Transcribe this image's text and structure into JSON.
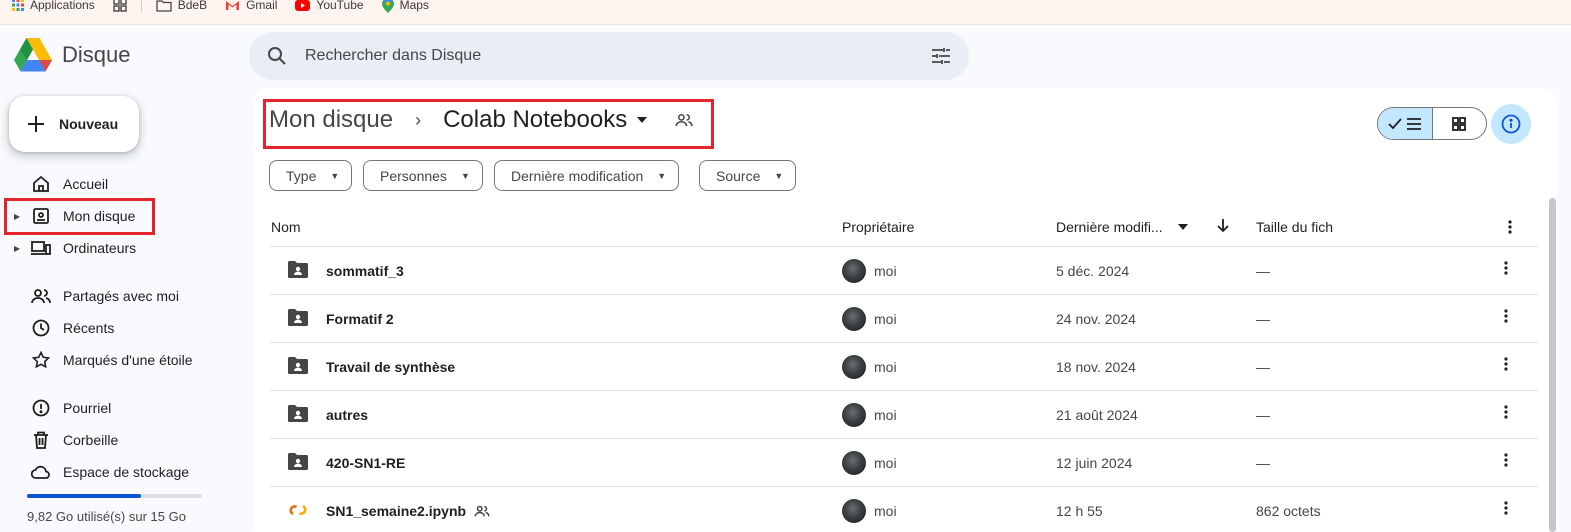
{
  "bookmarks": [
    {
      "label": "Applications",
      "icon": "apps-grid-icon"
    },
    {
      "label": "",
      "icon": "tab-groups-icon"
    },
    {
      "label": "BdeB",
      "icon": "folder-icon"
    },
    {
      "label": "Gmail",
      "icon": "gmail-icon"
    },
    {
      "label": "YouTube",
      "icon": "youtube-icon"
    },
    {
      "label": "Maps",
      "icon": "maps-icon"
    }
  ],
  "app": {
    "title": "Disque"
  },
  "search": {
    "placeholder": "Rechercher dans Disque"
  },
  "sidebar": {
    "new_label": "Nouveau",
    "items": [
      {
        "label": "Accueil",
        "icon": "home-icon"
      },
      {
        "label": "Mon disque",
        "icon": "my-drive-icon"
      },
      {
        "label": "Ordinateurs",
        "icon": "computers-icon"
      },
      {
        "label": "Partagés avec moi",
        "icon": "shared-icon"
      },
      {
        "label": "Récents",
        "icon": "clock-icon"
      },
      {
        "label": "Marqués d'une étoile",
        "icon": "star-icon"
      },
      {
        "label": "Pourriel",
        "icon": "spam-icon"
      },
      {
        "label": "Corbeille",
        "icon": "trash-icon"
      },
      {
        "label": "Espace de stockage",
        "icon": "cloud-icon"
      }
    ],
    "storage_text": "9,82 Go utilisé(s) sur 15 Go",
    "storage_used_fraction": 0.65
  },
  "breadcrumb": {
    "root": "Mon disque",
    "current": "Colab Notebooks"
  },
  "filters": [
    "Type",
    "Personnes",
    "Dernière modification",
    "Source"
  ],
  "table": {
    "headers": {
      "name": "Nom",
      "owner": "Propriétaire",
      "modified": "Dernière modifi...",
      "size": "Taille du fich"
    },
    "rows": [
      {
        "name": "sommatif_3",
        "type": "shared-folder",
        "owner": "moi",
        "date": "5 déc. 2024",
        "size": "—"
      },
      {
        "name": "Formatif 2",
        "type": "shared-folder",
        "owner": "moi",
        "date": "24 nov. 2024",
        "size": "—"
      },
      {
        "name": "Travail de synthèse",
        "type": "shared-folder",
        "owner": "moi",
        "date": "18 nov. 2024",
        "size": "—"
      },
      {
        "name": "autres",
        "type": "shared-folder",
        "owner": "moi",
        "date": "21 août 2024",
        "size": "—"
      },
      {
        "name": "420-SN1-RE",
        "type": "shared-folder",
        "owner": "moi",
        "date": "12 juin 2024",
        "size": "—"
      },
      {
        "name": "SN1_semaine2.ipynb",
        "type": "colab",
        "owner": "moi",
        "date": "12 h 55",
        "size": "862 octets"
      }
    ]
  },
  "colors": {
    "accent": "#0b57d0",
    "highlight_box": "#e3242b",
    "selected_toggle": "#c2e7ff"
  }
}
